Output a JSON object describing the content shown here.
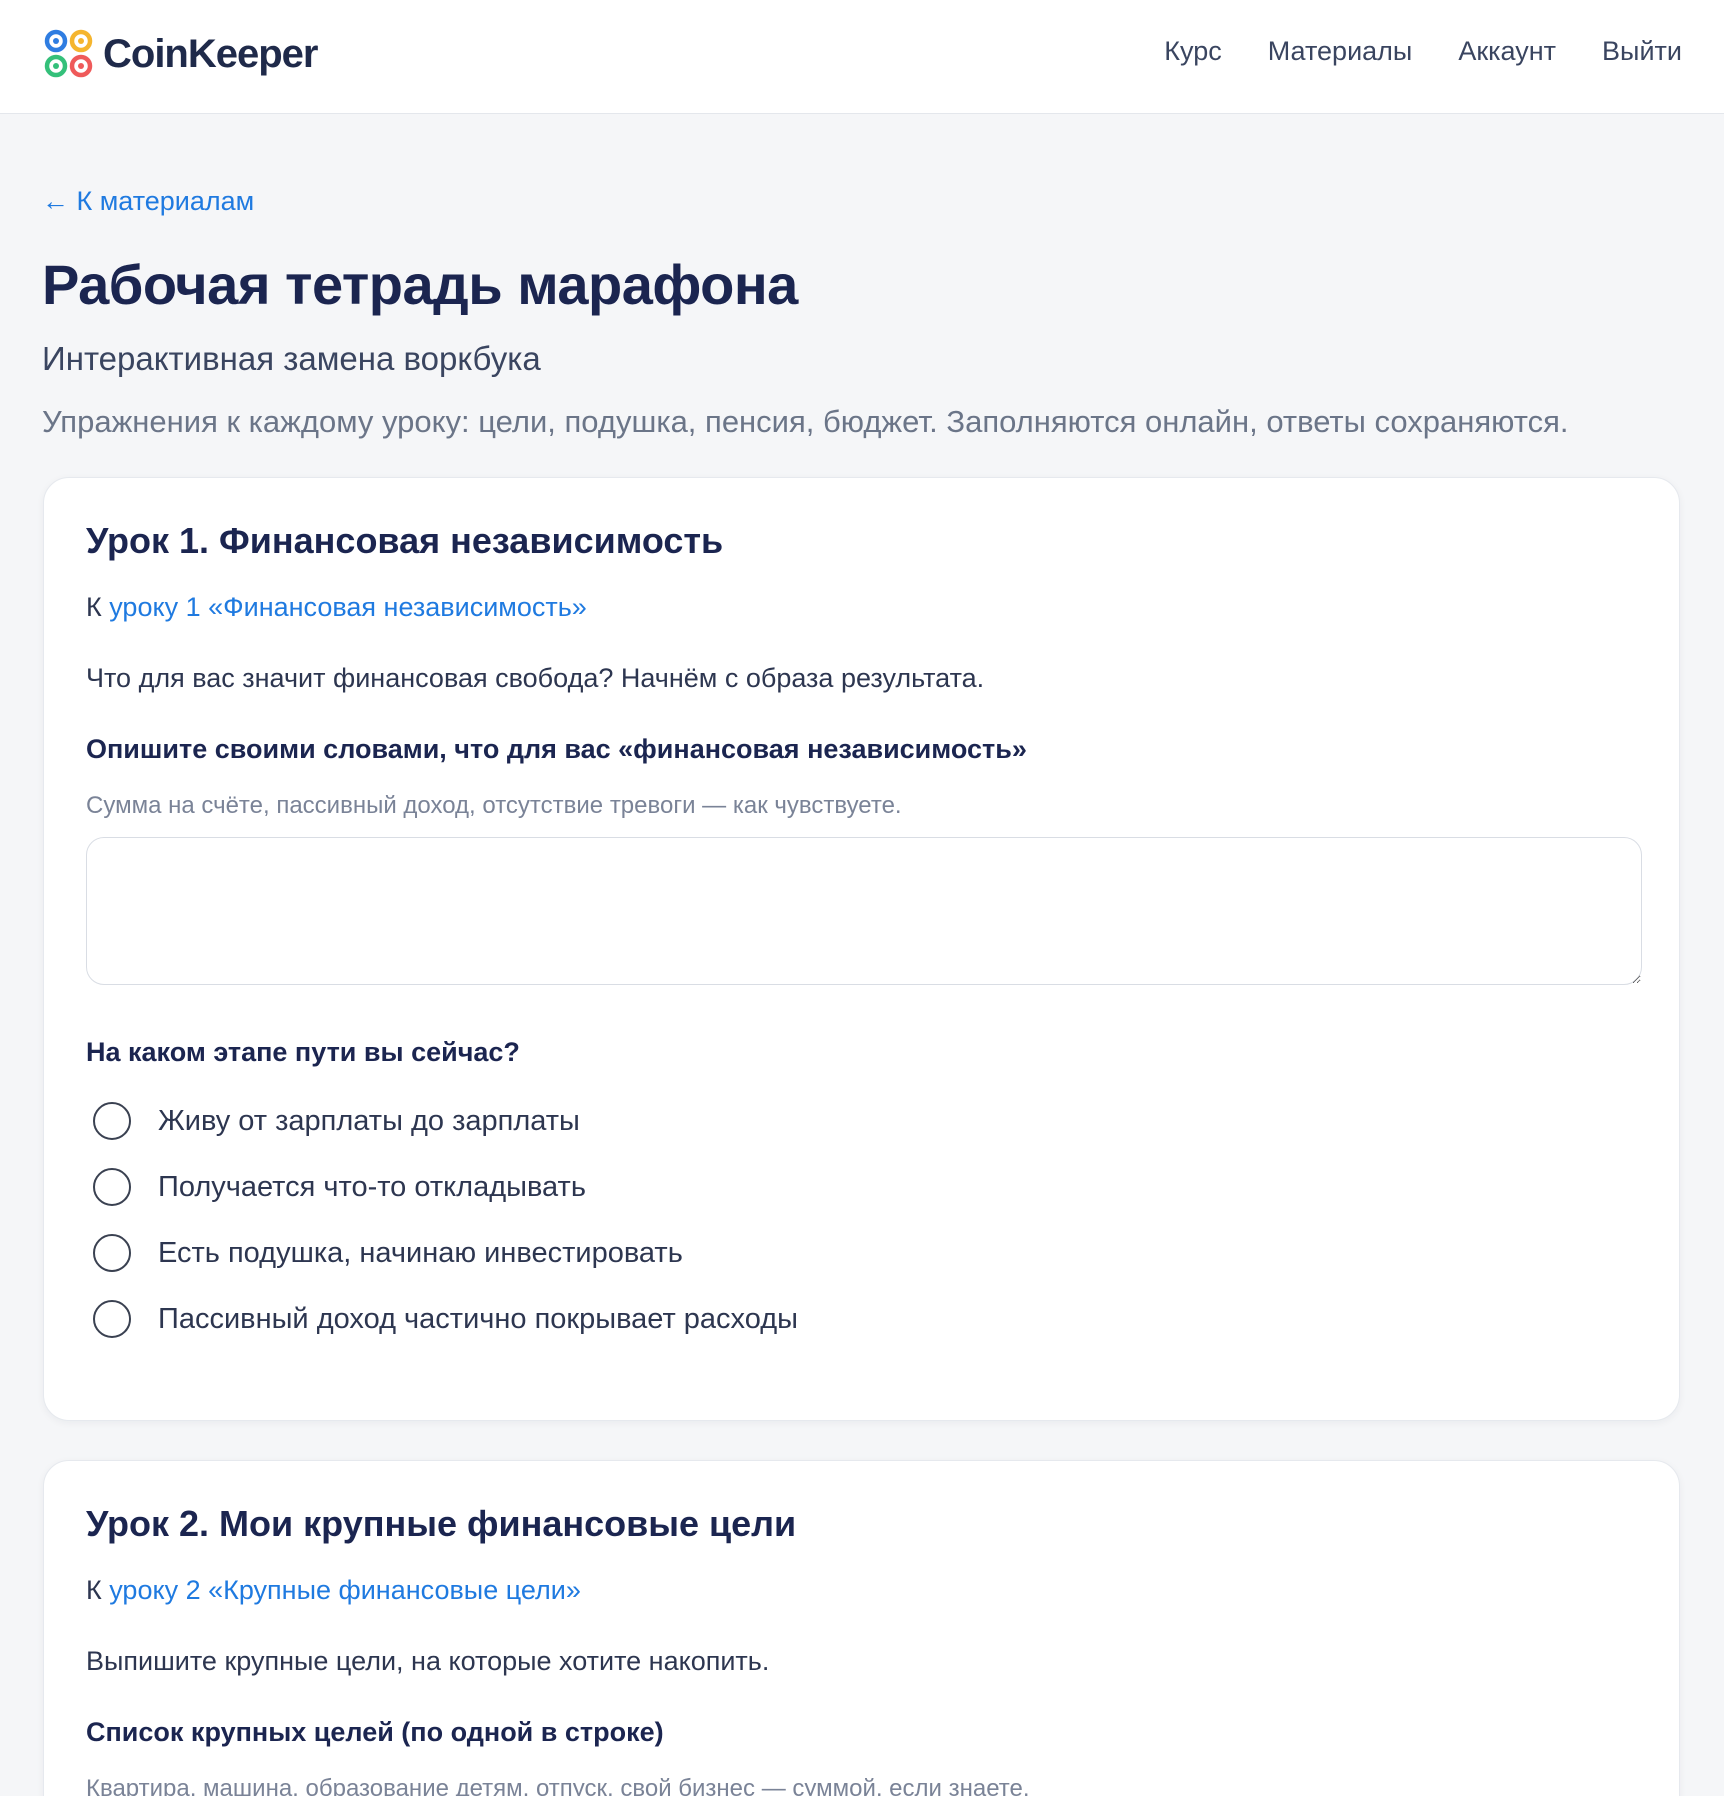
{
  "header": {
    "brand": "CoinKeeper",
    "nav": [
      "Курс",
      "Материалы",
      "Аккаунт",
      "Выйти"
    ]
  },
  "back_link": "← К материалам",
  "page": {
    "title": "Рабочая тетрадь марафона",
    "subtitle": "Интерактивная замена воркбука",
    "description": "Упражнения к каждому уроку: цели, подушка, пенсия, бюджет. Заполняются онлайн, ответы сохраняются."
  },
  "lesson1": {
    "title": "Урок 1. Финансовая независимость",
    "ref_prefix": "К ",
    "ref_link": "уроку 1 «Финансовая независимость»",
    "intro": "Что для вас значит финансовая свобода? Начнём с образа результата.",
    "q1_label": "Опишите своими словами, что для вас «финансовая независимость»",
    "q1_hint": "Сумма на счёте, пассивный доход, отсутствие тревоги — как чувствуете.",
    "q1_value": "",
    "q2_label": "На каком этапе пути вы сейчас?",
    "q2_options": [
      "Живу от зарплаты до зарплаты",
      "Получается что-то откладывать",
      "Есть подушка, начинаю инвестировать",
      "Пассивный доход частично покрывает расходы"
    ]
  },
  "lesson2": {
    "title": "Урок 2. Мои крупные финансовые цели",
    "ref_prefix": "К ",
    "ref_link": "уроку 2 «Крупные финансовые цели»",
    "intro": "Выпишите крупные цели, на которые хотите накопить.",
    "q1_label": "Список крупных целей (по одной в строке)",
    "q1_hint": "Квартира, машина, образование детям, отпуск, свой бизнес — суммой, если знаете."
  },
  "colors": {
    "accent": "#1f7ae0",
    "heading": "#1b2550",
    "background": "#f5f6f8"
  }
}
